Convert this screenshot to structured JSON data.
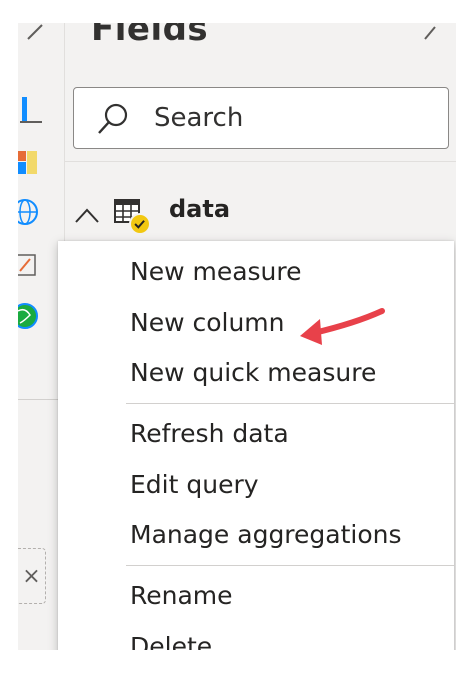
{
  "fields_pane": {
    "title": "Fields",
    "search_placeholder": "Search",
    "table": {
      "name": "data"
    }
  },
  "context_menu": {
    "items": [
      "New measure",
      "New column",
      "New quick measure",
      "Refresh data",
      "Edit query",
      "Manage aggregations",
      "Rename",
      "Delete"
    ]
  },
  "colors": {
    "pane_bg": "#f3f2f1",
    "badge": "#f2c811",
    "arrow": "#e8414a"
  },
  "icons": [
    "chevron-right-icon",
    "search-icon",
    "chevron-up-icon",
    "table-icon",
    "check-badge-icon",
    "annotation-arrow-icon"
  ]
}
